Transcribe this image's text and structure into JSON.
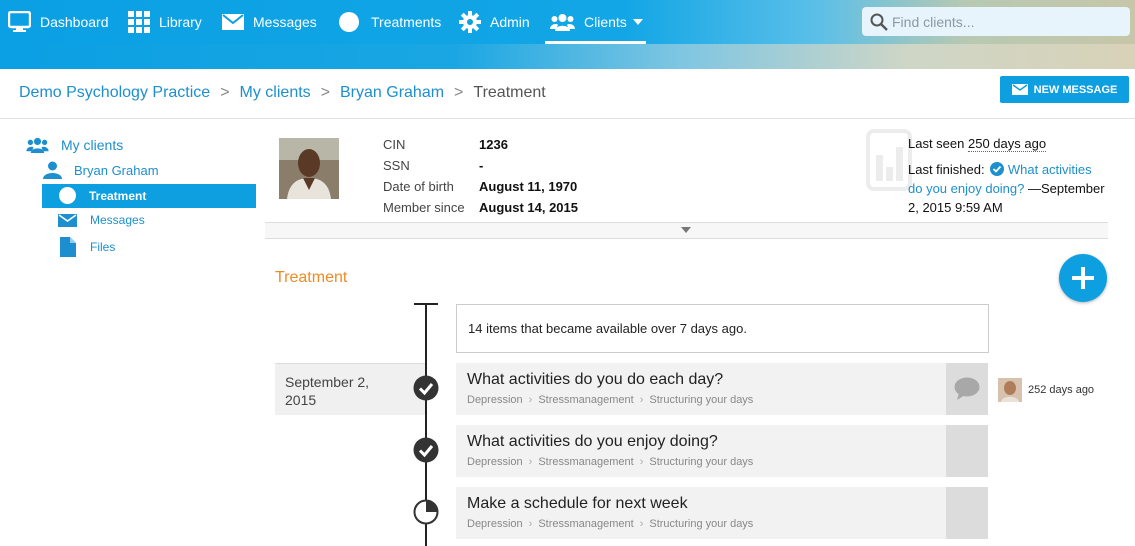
{
  "nav": {
    "items": [
      {
        "label": "Dashboard",
        "icon": "monitor-icon"
      },
      {
        "label": "Library",
        "icon": "grid-icon"
      },
      {
        "label": "Messages",
        "icon": "envelope-icon"
      },
      {
        "label": "Treatments",
        "icon": "circle-icon"
      },
      {
        "label": "Admin",
        "icon": "gear-icon"
      },
      {
        "label": "Clients",
        "icon": "users-icon",
        "active": true
      }
    ],
    "search_placeholder": "Find clients..."
  },
  "breadcrumb": {
    "items": [
      "Demo Psychology Practice",
      "My clients",
      "Bryan Graham"
    ],
    "current": "Treatment",
    "separator": ">"
  },
  "actions": {
    "new_message": "NEW MESSAGE"
  },
  "sidebar": {
    "my_clients": "My clients",
    "client_name": "Bryan Graham",
    "items": [
      {
        "label": "Treatment",
        "active": true
      },
      {
        "label": "Messages"
      },
      {
        "label": "Files"
      }
    ]
  },
  "client": {
    "fields": [
      {
        "label": "CIN",
        "value": "1236"
      },
      {
        "label": "SSN",
        "value": "-"
      },
      {
        "label": "Date of birth",
        "value": "August 11, 1970"
      },
      {
        "label": "Member since",
        "value": "August 14, 2015"
      }
    ],
    "last_seen_label": "Last seen",
    "last_seen_value": "250 days ago",
    "last_finished_label": "Last finished:",
    "last_finished_link_1": "What activities",
    "last_finished_link_2": "do you enjoy doing?",
    "last_finished_time_1": "—September",
    "last_finished_time_2": "2, 2015 9:59 AM"
  },
  "treatment": {
    "title": "Treatment",
    "summary": "14 items that became available over 7 days ago.",
    "date_line1": "September 2,",
    "date_line2": "2015",
    "activity_ago": "252 days ago",
    "tasks": [
      {
        "title": "What activities do you do each day?",
        "path": [
          "Depression",
          "Stressmanagement",
          "Structuring your days"
        ],
        "status": "completed"
      },
      {
        "title": "What activities do you enjoy doing?",
        "path": [
          "Depression",
          "Stressmanagement",
          "Structuring your days"
        ],
        "status": "completed"
      },
      {
        "title": "Make a schedule for next week",
        "path": [
          "Depression",
          "Stressmanagement",
          "Structuring your days"
        ],
        "status": "in-progress"
      }
    ]
  },
  "colors": {
    "accent": "#0e9fe0",
    "section": "#f08a24",
    "link": "#1d8fce"
  }
}
